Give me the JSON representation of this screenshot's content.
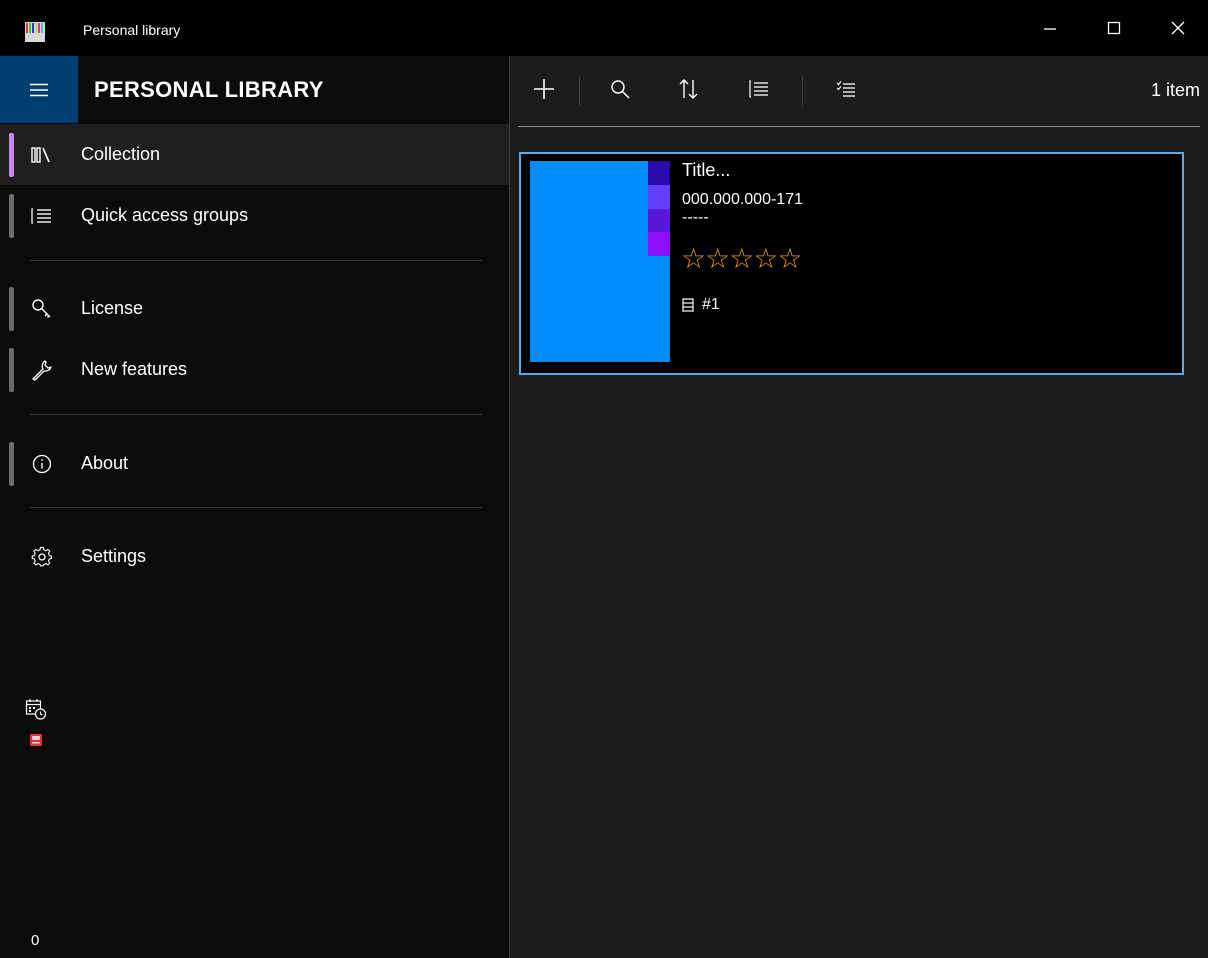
{
  "window": {
    "title": "Personal library"
  },
  "sidebar": {
    "title": "PERSONAL LIBRARY",
    "items": [
      {
        "label": "Collection",
        "icon": "library-icon"
      },
      {
        "label": "Quick access groups",
        "icon": "grouped-list-icon"
      },
      {
        "label": "License",
        "icon": "key-icon"
      },
      {
        "label": "New features",
        "icon": "wrench-icon"
      },
      {
        "label": "About",
        "icon": "info-icon"
      },
      {
        "label": "Settings",
        "icon": "gear-icon"
      }
    ],
    "footer": {
      "counter": "0"
    }
  },
  "toolbar": {
    "buttons": [
      "add-icon",
      "search-icon",
      "sort-icon",
      "list-icon",
      "checklist-icon"
    ],
    "item_count": "1 item"
  },
  "items": [
    {
      "title": "Title...",
      "isbn": "000.000.000-171",
      "dashes": "-----",
      "rating": 0,
      "rating_max": 5,
      "stars": "☆☆☆☆☆",
      "sequence": "#1",
      "cover_color": "#008cff",
      "cover_strip_colors": [
        "#2a0aa8",
        "#6340ff",
        "#5a18d4",
        "#8a10ff"
      ]
    }
  ],
  "colors": {
    "accent": "#5fa9e5",
    "hamburger_bg": "#003e70",
    "active_indicator": "#c987ff",
    "star": "#f0a000"
  }
}
